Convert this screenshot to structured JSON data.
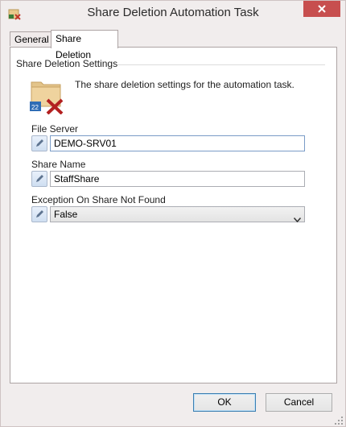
{
  "window": {
    "title": "Share Deletion Automation Task"
  },
  "tabs": [
    {
      "label": "General",
      "active": false
    },
    {
      "label": "Share Deletion",
      "active": true
    }
  ],
  "group": {
    "label": "Share Deletion Settings",
    "description": "The share deletion settings for the automation task.",
    "icon": "folder-delete-icon"
  },
  "fields": {
    "file_server": {
      "label": "File Server",
      "value": "DEMO-SRV01"
    },
    "share_name": {
      "label": "Share Name",
      "value": "StaffShare"
    },
    "exception": {
      "label": "Exception On Share Not Found",
      "value": "False"
    }
  },
  "buttons": {
    "ok": "OK",
    "cancel": "Cancel"
  },
  "colors": {
    "close_button": "#c74f4f",
    "accent_border": "#7a9cc7"
  }
}
